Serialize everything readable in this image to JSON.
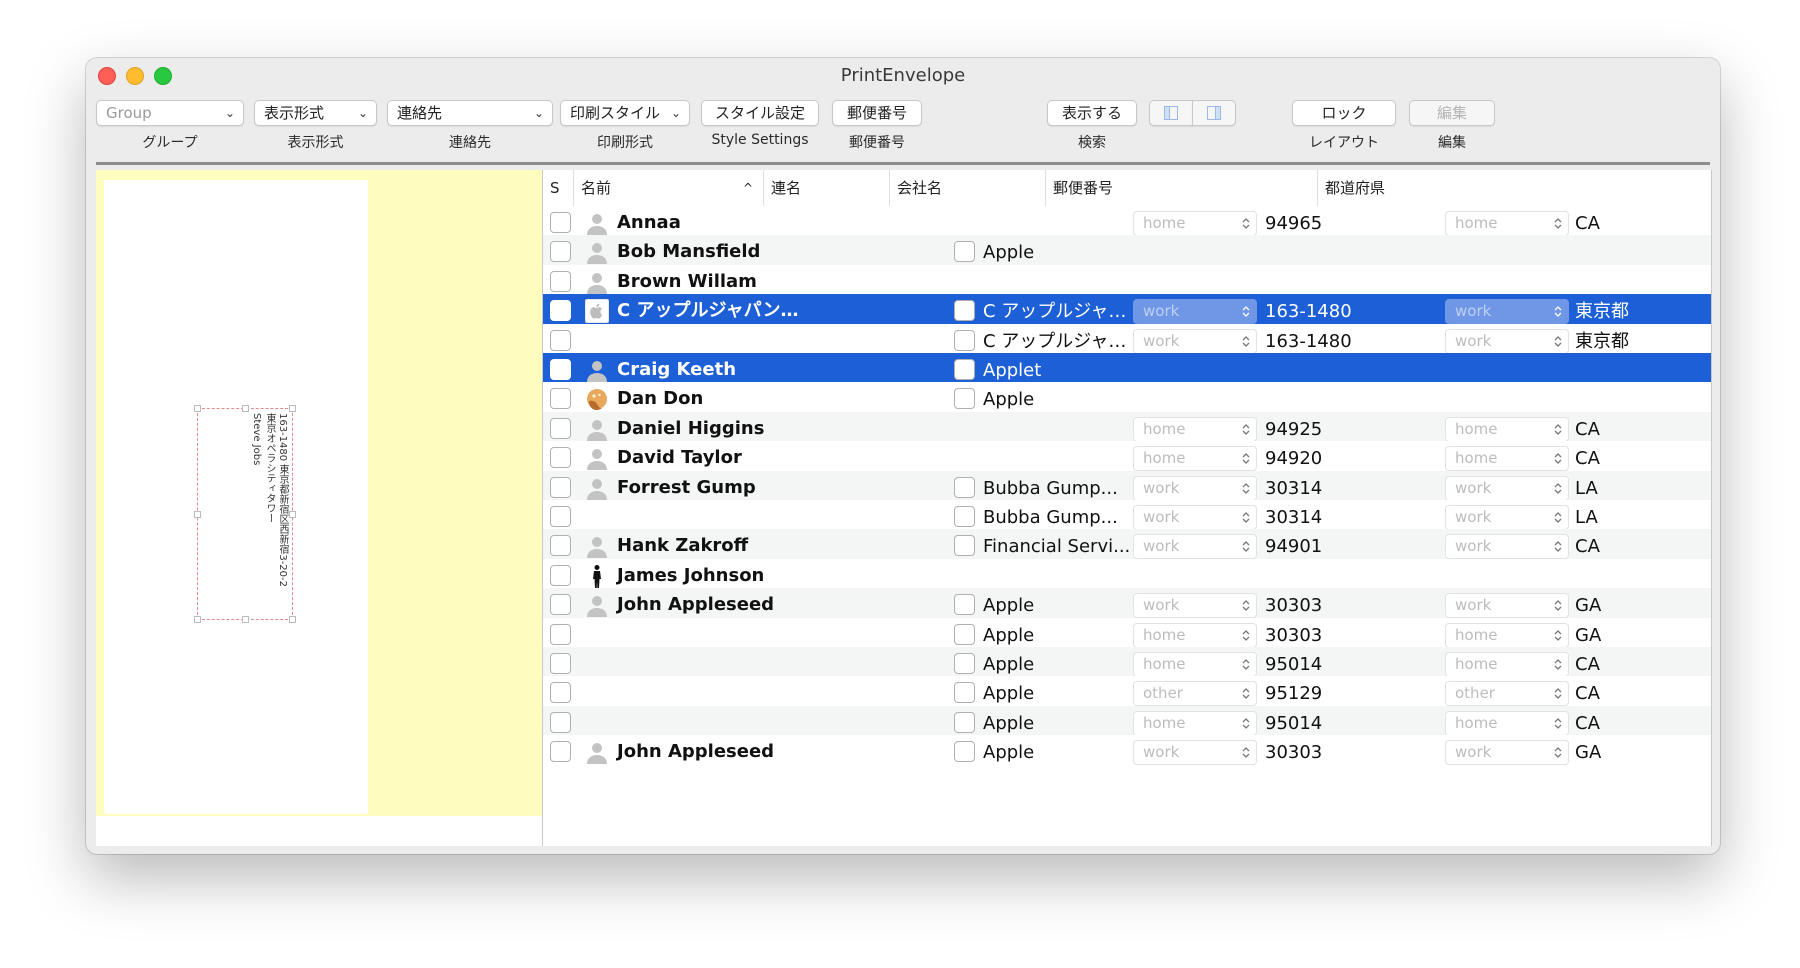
{
  "window": {
    "title": "PrintEnvelope"
  },
  "toolbar": {
    "group_popup": "Group",
    "display_popup": "表示形式",
    "contact_popup": "連絡先",
    "print_style_popup": "印刷スタイル",
    "style_settings_button": "スタイル設定",
    "postal_code_button": "郵便番号",
    "show_button": "表示する",
    "lock_button": "ロック",
    "edit_button": "編集",
    "labels": {
      "group": "グループ",
      "display": "表示形式",
      "contact": "連絡先",
      "print_style": "印刷形式",
      "style_settings": "Style Settings",
      "postal_code": "郵便番号",
      "search": "検索",
      "layout": "レイアウト",
      "edit": "編集"
    }
  },
  "preview": {
    "address_line1": "163-1480 東京都新宿区西新宿3-20-2",
    "address_line2": "東京オペラシティタワー",
    "address_line3": "Steve Jobs"
  },
  "table": {
    "headers": {
      "s": "S",
      "name": "名前",
      "alias": "連名",
      "company": "会社名",
      "postal": "郵便番号",
      "prefecture": "都道府県"
    },
    "sort_indicator": "^",
    "rows": [
      {
        "name": "Annaa",
        "avatar": "person-icon",
        "company": "",
        "zip_label": "home",
        "zip": "94965",
        "pref_label": "home",
        "pref": "CA"
      },
      {
        "name": "Bob Mansfield",
        "avatar": "person-icon",
        "company": "Apple",
        "zip_label": "",
        "zip": "",
        "pref_label": "",
        "pref": ""
      },
      {
        "name": "Brown Willam",
        "avatar": "person-icon",
        "company": "",
        "zip_label": "",
        "zip": "",
        "pref_label": "",
        "pref": ""
      },
      {
        "name": "C アップルジャパン…",
        "avatar": "apple-logo-icon",
        "company": "C アップルジャ…",
        "zip_label": "work",
        "zip": "163-1480",
        "pref_label": "work",
        "pref": "東京都",
        "selected": true
      },
      {
        "name": "",
        "avatar": "",
        "company": "C アップルジャ…",
        "zip_label": "work",
        "zip": "163-1480",
        "pref_label": "work",
        "pref": "東京都"
      },
      {
        "name": "Craig Keeth",
        "avatar": "person-icon",
        "company": "Applet",
        "zip_label": "",
        "zip": "",
        "pref_label": "",
        "pref": "",
        "selected": true
      },
      {
        "name": "Dan Don",
        "avatar": "cookie-icon",
        "company": "Apple",
        "zip_label": "",
        "zip": "",
        "pref_label": "",
        "pref": ""
      },
      {
        "name": "Daniel Higgins",
        "avatar": "person-icon",
        "company": "",
        "zip_label": "home",
        "zip": "94925",
        "pref_label": "home",
        "pref": "CA"
      },
      {
        "name": "David Taylor",
        "avatar": "person-icon",
        "company": "",
        "zip_label": "home",
        "zip": "94920",
        "pref_label": "home",
        "pref": "CA"
      },
      {
        "name": "Forrest Gump",
        "avatar": "person-icon",
        "company": "Bubba Gump...",
        "zip_label": "work",
        "zip": "30314",
        "pref_label": "work",
        "pref": "LA"
      },
      {
        "name": "",
        "avatar": "",
        "company": "Bubba Gump...",
        "zip_label": "work",
        "zip": "30314",
        "pref_label": "work",
        "pref": "LA"
      },
      {
        "name": "Hank Zakroff",
        "avatar": "person-icon",
        "company": "Financial Servi...",
        "zip_label": "work",
        "zip": "94901",
        "pref_label": "work",
        "pref": "CA"
      },
      {
        "name": "James Johnson",
        "avatar": "silhouette-icon",
        "company": "",
        "zip_label": "",
        "zip": "",
        "pref_label": "",
        "pref": ""
      },
      {
        "name": "John Appleseed",
        "avatar": "person-icon",
        "company": "Apple",
        "zip_label": "work",
        "zip": "30303",
        "pref_label": "work",
        "pref": "GA"
      },
      {
        "name": "",
        "avatar": "",
        "company": "Apple",
        "zip_label": "home",
        "zip": "30303",
        "pref_label": "home",
        "pref": "GA"
      },
      {
        "name": "",
        "avatar": "",
        "company": "Apple",
        "zip_label": "home",
        "zip": "95014",
        "pref_label": "home",
        "pref": "CA"
      },
      {
        "name": "",
        "avatar": "",
        "company": "Apple",
        "zip_label": "other",
        "zip": "95129",
        "pref_label": "other",
        "pref": "CA"
      },
      {
        "name": "",
        "avatar": "",
        "company": "Apple",
        "zip_label": "home",
        "zip": "95014",
        "pref_label": "home",
        "pref": "CA"
      },
      {
        "name": "John Appleseed",
        "avatar": "person-icon",
        "company": "Apple",
        "zip_label": "work",
        "zip": "30303",
        "pref_label": "work",
        "pref": "GA"
      }
    ]
  },
  "colors": {
    "selection": "#1d5fd6",
    "preview_background": "#fffdbd",
    "close": "#ff5f57",
    "minimize": "#febc2e",
    "zoom": "#28c840"
  }
}
